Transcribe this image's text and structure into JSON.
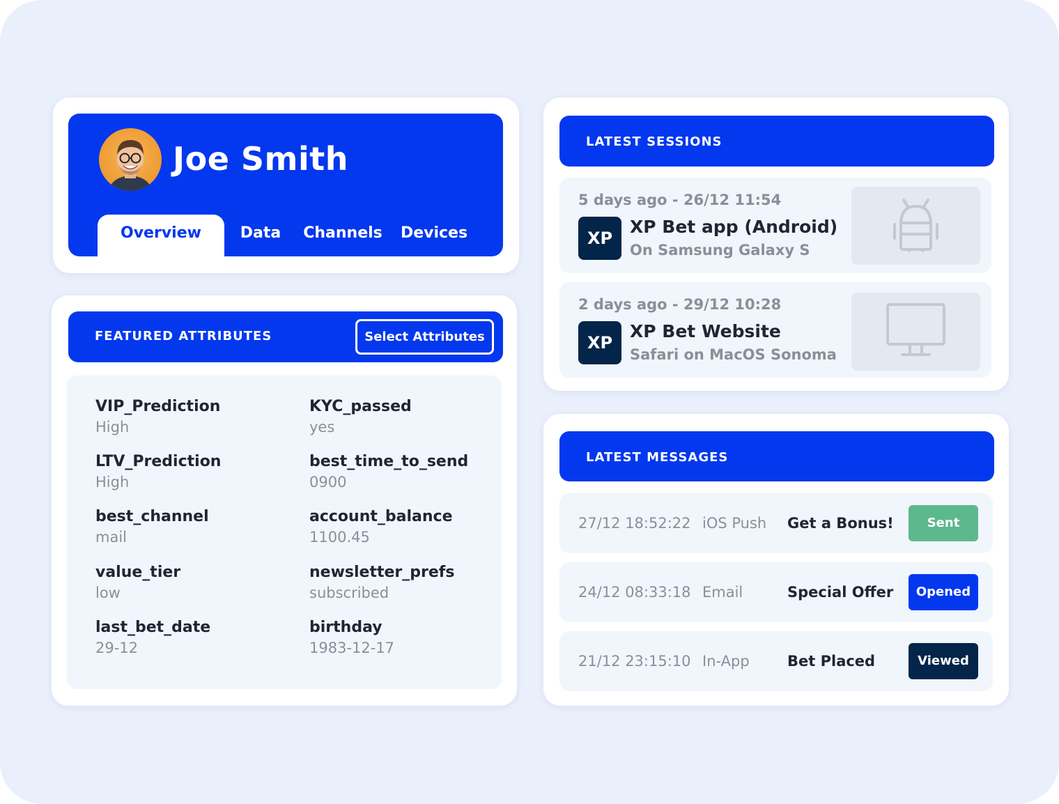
{
  "profile": {
    "name": "Joe Smith",
    "tabs": [
      {
        "label": "Overview",
        "active": true
      },
      {
        "label": "Data",
        "active": false
      },
      {
        "label": "Channels",
        "active": false
      },
      {
        "label": "Devices",
        "active": false
      }
    ]
  },
  "attributes": {
    "title": "FEATURED ATTRIBUTES",
    "select_button": "Select Attributes",
    "items": [
      {
        "name": "VIP_Prediction",
        "value": "High"
      },
      {
        "name": "KYC_passed",
        "value": "yes"
      },
      {
        "name": "LTV_Prediction",
        "value": "High"
      },
      {
        "name": "best_time_to_send",
        "value": "0900"
      },
      {
        "name": "best_channel",
        "value": "mail"
      },
      {
        "name": "account_balance",
        "value": "1100.45"
      },
      {
        "name": "value_tier",
        "value": "low"
      },
      {
        "name": "newsletter_prefs",
        "value": "subscribed"
      },
      {
        "name": "last_bet_date",
        "value": "29-12"
      },
      {
        "name": "birthday",
        "value": "1983-12-17"
      }
    ]
  },
  "sessions": {
    "title": "LATEST SESSIONS",
    "items": [
      {
        "time": "5 days ago - 26/12 11:54",
        "logo": "XP",
        "app": "XP Bet app (Android)",
        "device": "On Samsung Galaxy S",
        "icon": "android-icon"
      },
      {
        "time": "2 days ago - 29/12 10:28",
        "logo": "XP",
        "app": "XP Bet Website",
        "device": "Safari on MacOS Sonoma",
        "icon": "desktop-monitor-icon"
      }
    ]
  },
  "messages": {
    "title": "LATEST MESSAGES",
    "items": [
      {
        "time": "27/12 18:52:22",
        "channel": "iOS Push",
        "subject": "Get a Bonus!",
        "status": "Sent",
        "status_color": "#5cb98c"
      },
      {
        "time": "24/12 08:33:18",
        "channel": "Email",
        "subject": "Special Offer",
        "status": "Opened",
        "status_color": "#0338ee"
      },
      {
        "time": "21/12 23:15:10",
        "channel": "In-App",
        "subject": "Bet Placed",
        "status": "Viewed",
        "status_color": "#04254a"
      }
    ]
  },
  "colors": {
    "brand_blue": "#0338ee",
    "page_background": "#e9effb",
    "muted_text": "#8a8f98",
    "dark_navy": "#04254a",
    "sent_green": "#5cb98c"
  }
}
